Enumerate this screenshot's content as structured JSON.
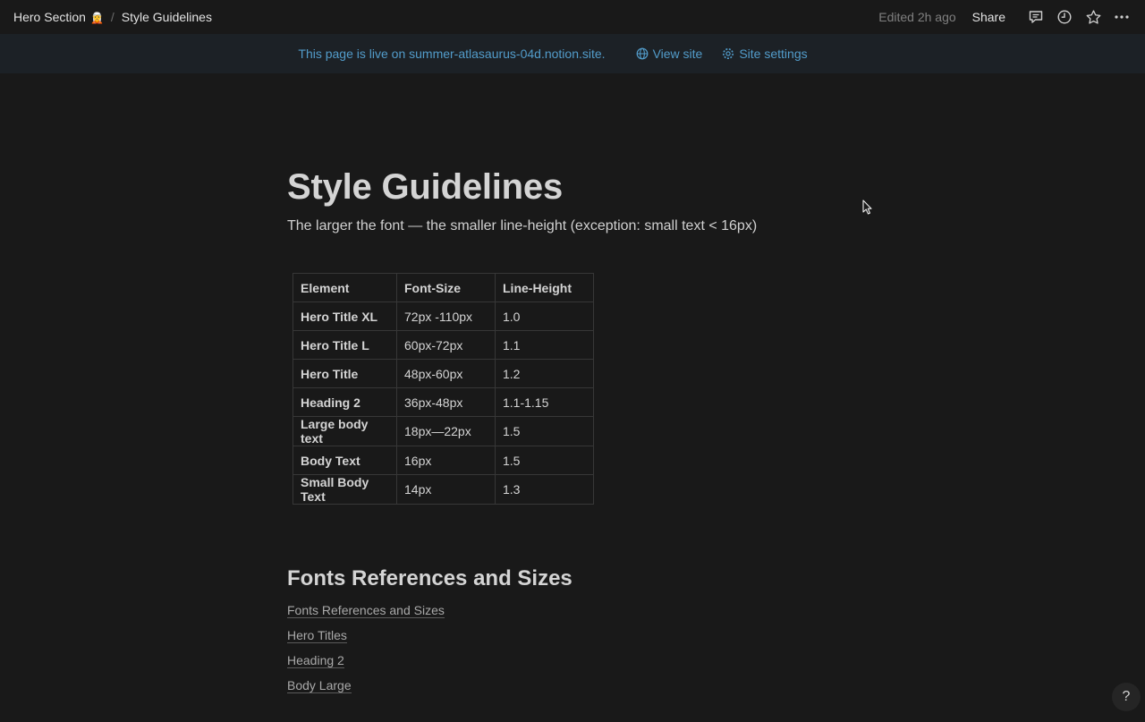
{
  "topbar": {
    "breadcrumb": [
      {
        "label": "Hero Section",
        "emoji": "🧝"
      },
      {
        "label": "Style Guidelines"
      }
    ],
    "separator": "/",
    "edited": "Edited 2h ago",
    "share_label": "Share",
    "icons": [
      "comment-icon",
      "clock-icon",
      "star-icon",
      "more-icon"
    ]
  },
  "banner": {
    "text": "This page is live on summer-atlasaurus-04d.notion.site.",
    "view_site": "View site",
    "site_settings": "Site settings",
    "color": "#529cca"
  },
  "page": {
    "title": "Style Guidelines",
    "subtitle": "The larger the font — the smaller line-height (exception: small text < 16px)"
  },
  "table": {
    "headers": [
      "Element",
      "Font-Size",
      "Line-Height"
    ],
    "rows": [
      [
        "Hero Title XL",
        "72px -110px",
        "1.0"
      ],
      [
        "Hero Title L",
        "60px-72px",
        "1.1"
      ],
      [
        "Hero Title",
        "48px-60px",
        "1.2"
      ],
      [
        "Heading 2",
        "36px-48px",
        "1.1-1.15"
      ],
      [
        "Large body text",
        "18px—22px",
        "1.5"
      ],
      [
        "Body Text",
        "16px",
        "1.5"
      ],
      [
        "Small Body Text",
        "14px",
        "1.3"
      ]
    ]
  },
  "fonts_section": {
    "heading": "Fonts References and Sizes",
    "links": [
      "Fonts References and Sizes",
      "Hero Titles",
      "Heading 2",
      "Body Large"
    ]
  },
  "help_label": "?"
}
